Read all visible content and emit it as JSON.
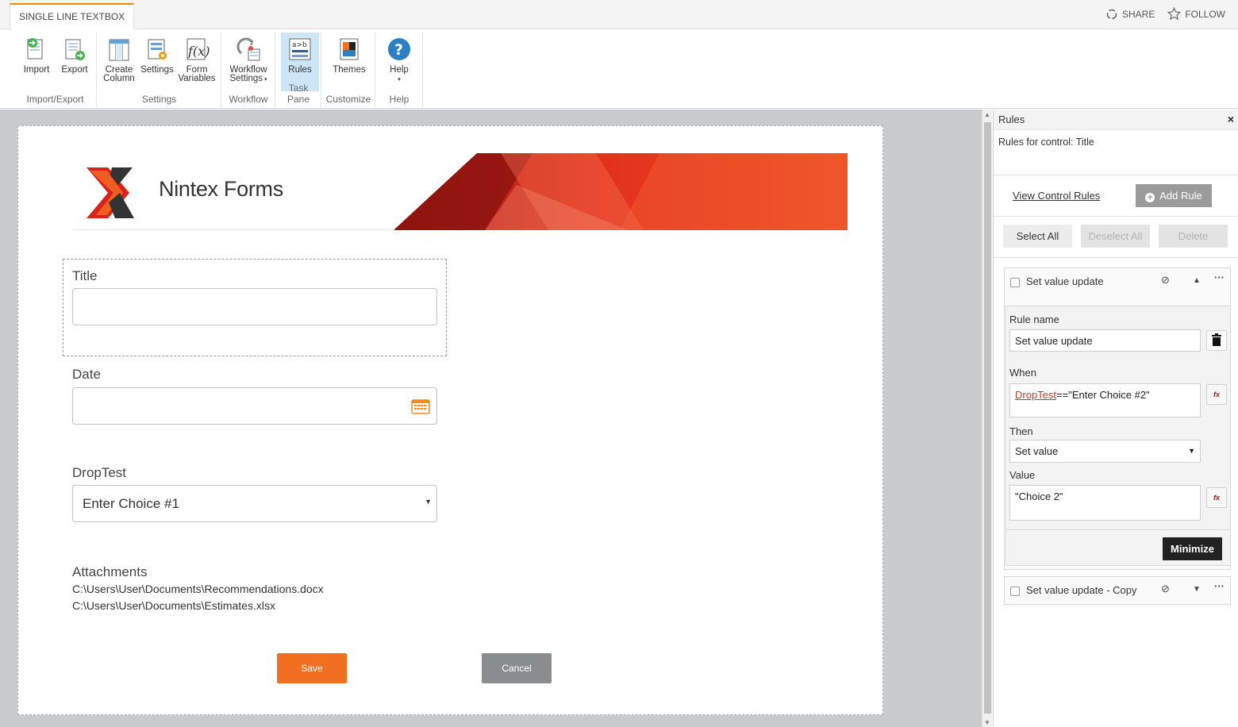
{
  "topbar": {
    "context_tab": "SINGLE LINE TEXTBOX",
    "share": "SHARE",
    "follow": "FOLLOW"
  },
  "ribbon": {
    "groups": [
      {
        "label": "Import/Export",
        "buttons": [
          "Import",
          "Export"
        ]
      },
      {
        "label": "Settings",
        "buttons": [
          "Create Column",
          "Settings",
          "Form Variables"
        ]
      },
      {
        "label": "Workflow",
        "buttons": [
          "Workflow Settings"
        ]
      },
      {
        "label": "Task Pane",
        "buttons": [
          "Rules"
        ]
      },
      {
        "label": "Customize",
        "buttons": [
          "Themes"
        ]
      },
      {
        "label": "Help",
        "buttons": [
          "Help"
        ]
      }
    ],
    "create_column_l1": "Create",
    "create_column_l2": "Column",
    "form_variables_l1": "Form",
    "form_variables_l2": "Variables",
    "workflow_settings_l1": "Workflow",
    "workflow_settings_l2": "Settings"
  },
  "form": {
    "logo_text": "Nintex Forms",
    "title_label": "Title",
    "title_value": "",
    "date_label": "Date",
    "date_value": "",
    "droptest_label": "DropTest",
    "droptest_value": "Enter Choice #1",
    "attachments_label": "Attachments",
    "attachments": [
      "C:\\Users\\User\\Documents\\Recommendations.docx",
      "C:\\Users\\User\\Documents\\Estimates.xlsx"
    ],
    "save_label": "Save",
    "cancel_label": "Cancel"
  },
  "rules_panel": {
    "title": "Rules",
    "close": "×",
    "subtitle": "Rules for control: Title",
    "view_control_rules": "View Control Rules",
    "add_rule": "Add Rule",
    "select_all": "Select All",
    "deselect_all": "Deselect All",
    "delete": "Delete",
    "rules": [
      {
        "name": "Set value update",
        "expanded": true,
        "rule_name_label": "Rule name",
        "rule_name_value": "Set value update",
        "when_label": "When",
        "when_field": "DropTest",
        "when_expr": "==\"Enter Choice #2\"",
        "then_label": "Then",
        "then_value": "Set value",
        "value_label": "Value",
        "value_value": "\"Choice 2\"",
        "minimize": "Minimize"
      },
      {
        "name": "Set value update - Copy",
        "expanded": false
      }
    ]
  },
  "colors": {
    "accent_orange": "#f26f21",
    "ribbon_active": "#cde6f7",
    "cancel_gray": "#8a8d8f",
    "link_red": "#c0392b"
  }
}
